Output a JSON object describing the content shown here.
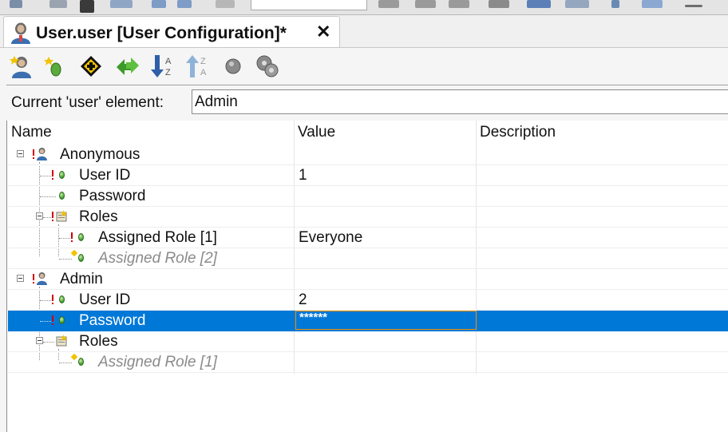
{
  "editor_tab": {
    "title": "User.user [User Configuration]*",
    "close_glyph": "✕"
  },
  "toolbar": {
    "buttons": [
      "add-user-icon",
      "add-element-icon",
      "navigate-icon",
      "swap-icon",
      "sort-ascending-icon",
      "sort-descending-icon",
      "gray-circle-icon",
      "gears-icon"
    ]
  },
  "current_element": {
    "label": "Current 'user' element:",
    "value": "Admin"
  },
  "columns": {
    "name": "Name",
    "value": "Value",
    "description": "Description"
  },
  "tree": [
    {
      "label": "Anonymous",
      "value": ""
    },
    {
      "label": "User ID",
      "value": "1"
    },
    {
      "label": "Password",
      "value": ""
    },
    {
      "label": "Roles",
      "value": ""
    },
    {
      "label": "Assigned Role [1]",
      "value": "Everyone"
    },
    {
      "label": "Assigned Role [2]",
      "value": ""
    },
    {
      "label": "Admin",
      "value": ""
    },
    {
      "label": "User ID",
      "value": "2"
    },
    {
      "label": "Password",
      "value": "******"
    },
    {
      "label": "Roles",
      "value": ""
    },
    {
      "label": "Assigned Role [1]",
      "value": ""
    }
  ],
  "colors": {
    "selection": "#0078d7",
    "edit_border": "#f39000",
    "required_marker": "#d00000",
    "leaf_green": "#3d9a2a"
  }
}
